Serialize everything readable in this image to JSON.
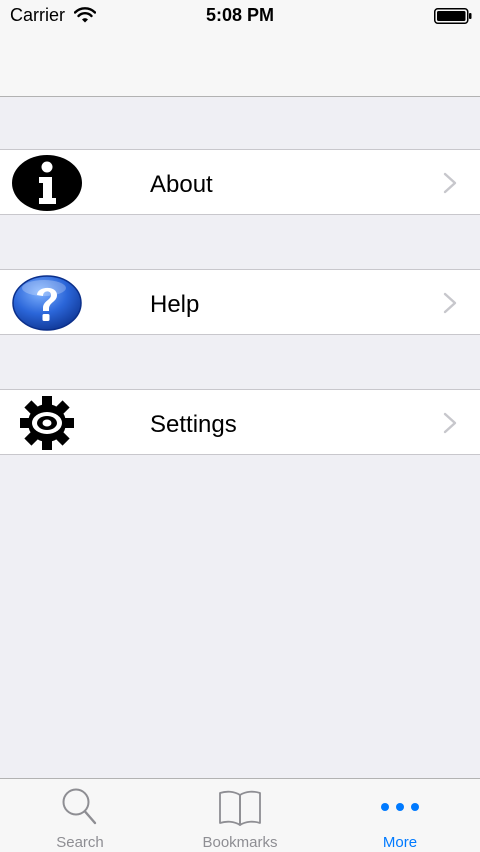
{
  "status_bar": {
    "carrier": "Carrier",
    "time": "5:08 PM",
    "icons": [
      "wifi-icon",
      "battery-icon"
    ]
  },
  "menu": {
    "items": [
      {
        "label": "About",
        "icon": "info-icon"
      },
      {
        "label": "Help",
        "icon": "help-icon"
      },
      {
        "label": "Settings",
        "icon": "gear-icon"
      }
    ]
  },
  "tab_bar": {
    "tabs": [
      {
        "label": "Search",
        "icon": "search-icon",
        "active": false
      },
      {
        "label": "Bookmarks",
        "icon": "bookmarks-icon",
        "active": false
      },
      {
        "label": "More",
        "icon": "more-icon",
        "active": true
      }
    ]
  },
  "colors": {
    "background": "#efeff4",
    "accent": "#007aff",
    "inactive": "#8e8e93",
    "separator": "#c8c7cc"
  }
}
